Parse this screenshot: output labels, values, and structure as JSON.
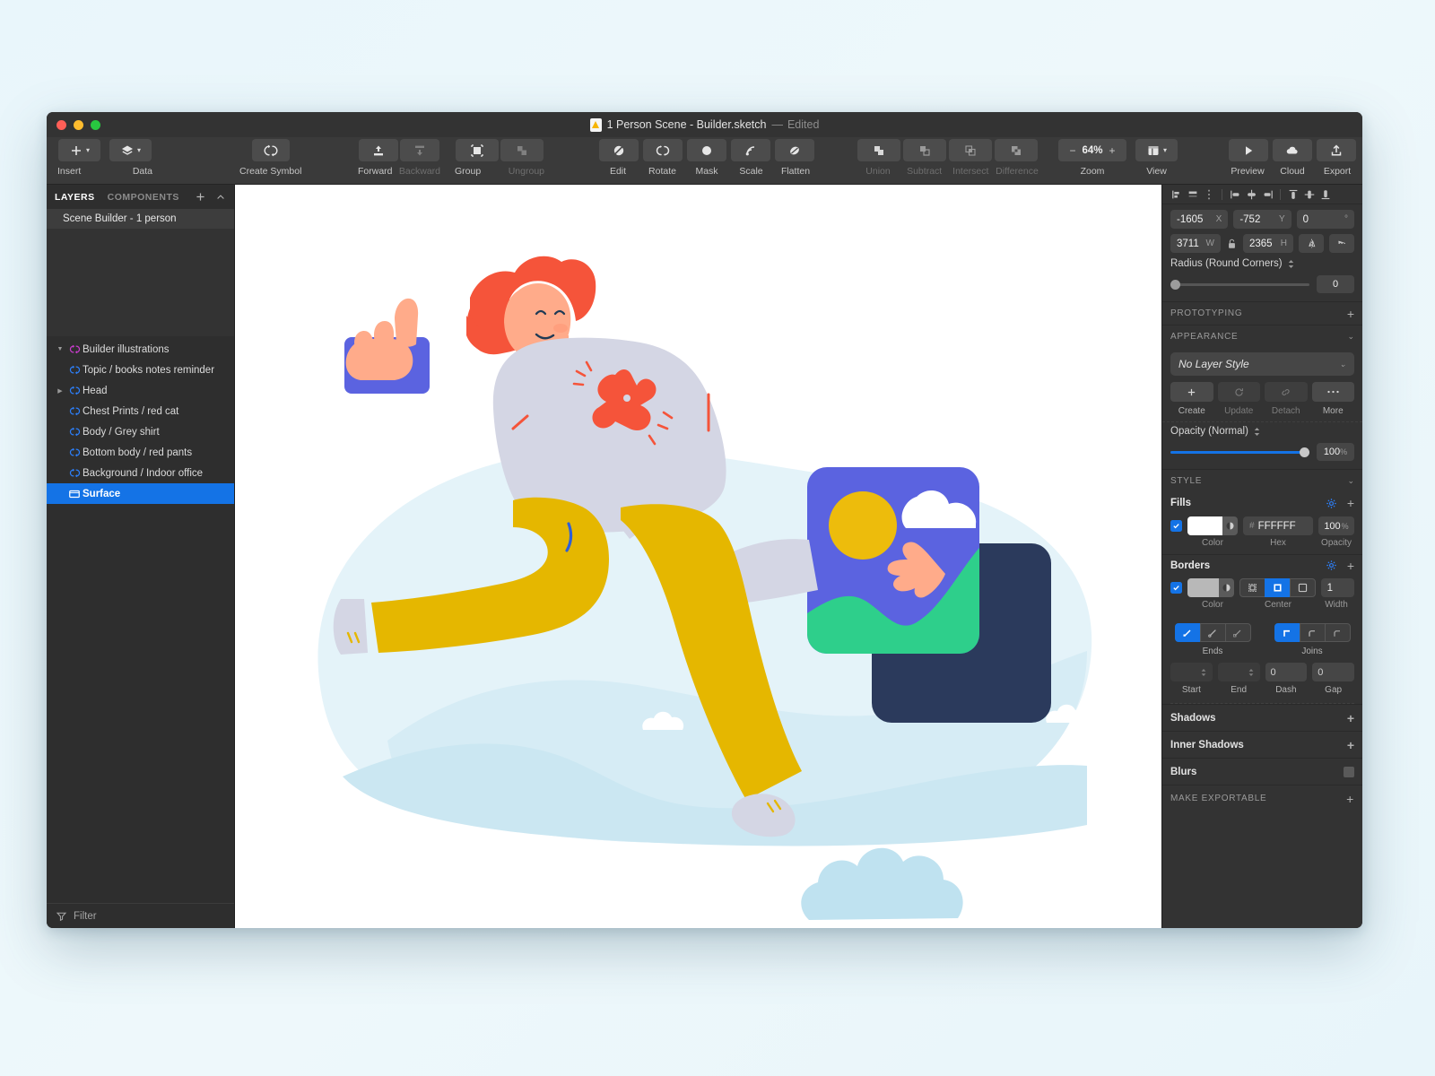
{
  "window": {
    "title": "1 Person Scene - Builder.sketch",
    "title_separator": "—",
    "edited_label": "Edited"
  },
  "toolbar": {
    "groups": [
      {
        "label": "Insert",
        "icon": "plus-icon"
      },
      {
        "label": "Data",
        "icon": "layers-stack-icon"
      },
      {
        "label": "Create Symbol",
        "icon": "symbol-icon"
      },
      {
        "label": "Forward",
        "icon": "bring-forward-icon"
      },
      {
        "label": "Backward",
        "icon": "send-backward-icon"
      },
      {
        "label": "Group",
        "icon": "group-icon"
      },
      {
        "label": "Ungroup",
        "icon": "ungroup-icon"
      },
      {
        "label": "Edit",
        "icon": "edit-icon"
      },
      {
        "label": "Rotate",
        "icon": "rotate-icon"
      },
      {
        "label": "Mask",
        "icon": "mask-icon"
      },
      {
        "label": "Scale",
        "icon": "scale-icon"
      },
      {
        "label": "Flatten",
        "icon": "flatten-icon"
      },
      {
        "label": "Union",
        "icon": "union-icon"
      },
      {
        "label": "Subtract",
        "icon": "subtract-icon"
      },
      {
        "label": "Intersect",
        "icon": "intersect-icon"
      },
      {
        "label": "Difference",
        "icon": "difference-icon"
      },
      {
        "label": "Zoom",
        "icon": "zoom-icon"
      },
      {
        "label": "View",
        "icon": "view-icon"
      },
      {
        "label": "Preview",
        "icon": "play-icon"
      },
      {
        "label": "Cloud",
        "icon": "cloud-icon"
      },
      {
        "label": "Export",
        "icon": "export-icon"
      }
    ],
    "zoom_value": "64%",
    "zoom_minus": "−",
    "zoom_plus": "+"
  },
  "left_panel": {
    "tabs": [
      {
        "label": "LAYERS",
        "active": true
      },
      {
        "label": "COMPONENTS",
        "active": false
      }
    ],
    "add_icon": "plus-icon",
    "collapse_icon": "chevron-up-icon",
    "page_name": "Scene Builder - 1 person",
    "layers": [
      {
        "label": "Builder illustrations",
        "indent": 0,
        "disclosure": "open",
        "icon": "symbol-instance-icon",
        "icon_color": "#c93ccd",
        "selected": false
      },
      {
        "label": "Topic / books notes reminder",
        "indent": 1,
        "disclosure": "none",
        "icon": "symbol-instance-icon",
        "icon_color": "#2d7ff9",
        "selected": false
      },
      {
        "label": "Head",
        "indent": 1,
        "disclosure": "closed",
        "icon": "symbol-instance-icon",
        "icon_color": "#2d7ff9",
        "selected": false
      },
      {
        "label": "Chest Prints / red cat",
        "indent": 1,
        "disclosure": "none",
        "icon": "symbol-instance-icon",
        "icon_color": "#2d7ff9",
        "selected": false
      },
      {
        "label": "Body / Grey shirt",
        "indent": 1,
        "disclosure": "none",
        "icon": "symbol-instance-icon",
        "icon_color": "#2d7ff9",
        "selected": false
      },
      {
        "label": "Bottom body / red pants",
        "indent": 1,
        "disclosure": "none",
        "icon": "symbol-instance-icon",
        "icon_color": "#2d7ff9",
        "selected": false
      },
      {
        "label": "Background / Indoor office",
        "indent": 1,
        "disclosure": "none",
        "icon": "symbol-instance-icon",
        "icon_color": "#2d7ff9",
        "selected": false
      },
      {
        "label": "Surface",
        "indent": 1,
        "disclosure": "none",
        "icon": "artboard-icon",
        "icon_color": "#ffffff",
        "selected": true
      }
    ],
    "filter_placeholder": "Filter",
    "filter_icon": "filter-icon"
  },
  "inspector": {
    "position": {
      "x_value": "-1605",
      "x_label": "X",
      "y_value": "-752",
      "y_label": "Y",
      "rotation_value": "0",
      "rotation_label": "°",
      "w_value": "3711",
      "w_label": "W",
      "h_value": "2365",
      "h_label": "H",
      "lock_icon": "lock-open-icon",
      "flip_h_icon": "flip-horizontal-icon",
      "flip_v_icon": "flip-vertical-icon"
    },
    "radius": {
      "label": "Radius (Round Corners)",
      "value": "0",
      "slider_percent": 0
    },
    "sections": {
      "prototyping": "PROTOTYPING",
      "appearance": "APPEARANCE",
      "style": "STYLE",
      "make_exportable": "MAKE EXPORTABLE"
    },
    "layer_style": "No Layer Style",
    "style_actions": [
      {
        "label": "Create",
        "icon": "plus-icon",
        "enabled": true
      },
      {
        "label": "Update",
        "icon": "refresh-icon",
        "enabled": false
      },
      {
        "label": "Detach",
        "icon": "detach-icon",
        "enabled": false
      },
      {
        "label": "More",
        "icon": "ellipsis-icon",
        "enabled": true
      }
    ],
    "opacity": {
      "label": "Opacity (Normal)",
      "value": "100",
      "unit": "%",
      "percent": 100
    },
    "fills": {
      "title": "Fills",
      "enabled": true,
      "color_swatch": "#FFFFFF",
      "hex_value": "FFFFFF",
      "hex_prefix": "#",
      "opacity_value": "100",
      "opacity_unit": "%",
      "sub_color": "Color",
      "sub_hex": "Hex",
      "sub_opacity": "Opacity",
      "gear_icon": "gear-icon",
      "plus_icon": "plus-icon"
    },
    "borders": {
      "title": "Borders",
      "enabled": true,
      "color_swatch": "#b8b8b8",
      "sub_color": "Color",
      "position_options": [
        "inside",
        "center",
        "outside"
      ],
      "position_selected": "Center",
      "sub_position": "Center",
      "width_value": "1",
      "sub_width": "Width",
      "gear_icon": "gear-icon",
      "plus_icon": "plus-icon"
    },
    "line_ends": {
      "label": "Ends",
      "selected_index": 0
    },
    "line_joins": {
      "label": "Joins",
      "selected_index": 0
    },
    "dash_fields": [
      {
        "label": "Start",
        "value": "",
        "enabled": false
      },
      {
        "label": "End",
        "value": "",
        "enabled": false
      },
      {
        "label": "Dash",
        "value": "0",
        "enabled": true
      },
      {
        "label": "Gap",
        "value": "0",
        "enabled": true
      }
    ],
    "collapsed_sections": [
      {
        "label": "Shadows",
        "control": "plus"
      },
      {
        "label": "Inner Shadows",
        "control": "plus"
      },
      {
        "label": "Blurs",
        "control": "square"
      }
    ]
  },
  "canvas": {
    "artwork_name": "running-person-illustration",
    "colors": {
      "blob_light": "#e4f3f9",
      "blob_mid": "#cfeaf3",
      "blob_dark": "#c3e4f0",
      "shirt": "#d4d6e4",
      "pants": "#e5b700",
      "hair": "#f5543a",
      "skin": "#ffab8a",
      "tablet_blue": "#5b63e0",
      "card_blue": "#5b63e0",
      "card_navy": "#2b3a5c",
      "card_green": "#2ecf8b",
      "card_sun": "#edbc0c",
      "shoe": "#d4d6e4",
      "white": "#ffffff"
    }
  }
}
